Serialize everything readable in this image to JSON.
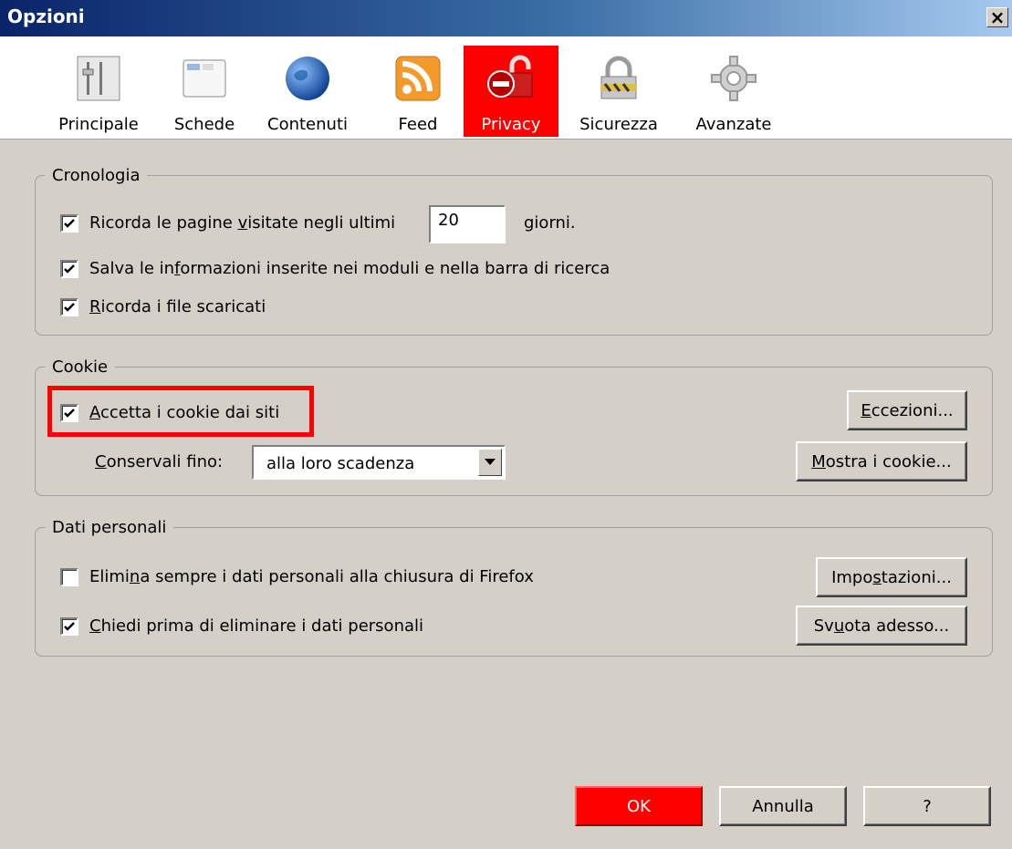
{
  "window": {
    "title": "Opzioni",
    "close": "×"
  },
  "tabs": [
    {
      "label": "Principale",
      "icon": "main-sliders-icon",
      "active": false
    },
    {
      "label": "Schede",
      "icon": "tabs-window-icon",
      "active": false
    },
    {
      "label": "Contenuti",
      "icon": "globe-icon",
      "active": false
    },
    {
      "label": "Feed",
      "icon": "rss-icon",
      "active": false
    },
    {
      "label": "Privacy",
      "icon": "privacy-lock-icon",
      "active": true
    },
    {
      "label": "Sicurezza",
      "icon": "padlock-icon",
      "active": false
    },
    {
      "label": "Avanzate",
      "icon": "gear-icon",
      "active": false
    }
  ],
  "history": {
    "legend": "Cronologia",
    "remember_pages": {
      "pre": "Ricorda le pagine ",
      "u": "v",
      "post": "isitate negli ultimi",
      "checked": true
    },
    "days_value": "20",
    "days_suffix": "giorni.",
    "save_forms": {
      "pre": "Salva le in",
      "u": "f",
      "post": "ormazioni inserite nei moduli e nella barra di ricerca",
      "checked": true
    },
    "remember_downloads": {
      "pre": "",
      "u": "R",
      "post": "icorda i file scaricati",
      "checked": true
    }
  },
  "cookie": {
    "legend": "Cookie",
    "accept": {
      "pre": "",
      "u": "A",
      "post": "ccetta i cookie dai siti",
      "checked": true
    },
    "keep_label": {
      "pre": "",
      "u": "C",
      "post": "onservali fino:"
    },
    "keep_value": "alla loro scadenza",
    "exceptions_button": {
      "pre": "",
      "u": "E",
      "post": "ccezioni..."
    },
    "show_button": {
      "pre": "",
      "u": "M",
      "post": "ostra i cookie..."
    }
  },
  "personal": {
    "legend": "Dati personali",
    "clear_on_close": {
      "pre": "Elimi",
      "u": "n",
      "post": "a sempre i dati personali alla chiusura di Firefox",
      "checked": false
    },
    "ask_before": {
      "pre": "",
      "u": "C",
      "post": "hiedi prima di eliminare i dati personali",
      "checked": true
    },
    "settings_button": {
      "pre": "Impo",
      "u": "s",
      "post": "tazioni..."
    },
    "clear_now_button": {
      "pre": "Sv",
      "u": "u",
      "post": "ota adesso..."
    }
  },
  "footer": {
    "ok": "OK",
    "cancel": "Annulla",
    "help": "?"
  },
  "colors": {
    "highlight": "#ff0000",
    "face": "#d4d0c8",
    "title_start": "#0a246a",
    "title_end": "#a6caf0"
  }
}
